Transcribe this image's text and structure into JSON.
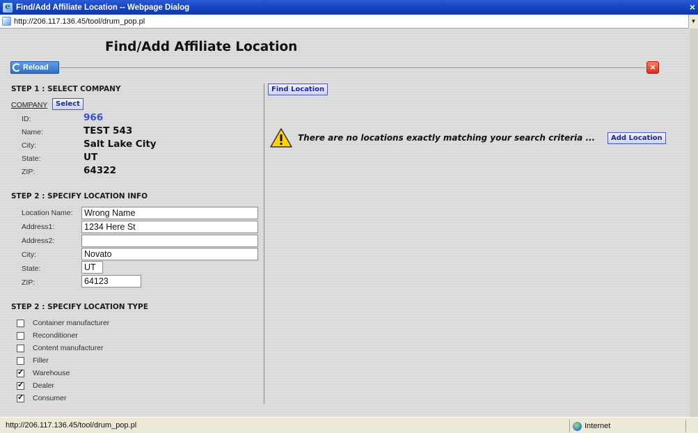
{
  "window": {
    "title": "Find/Add Affiliate Location -- Webpage Dialog",
    "close_glyph": "×",
    "address": "http://206.117.136.45/tool/drum_pop.pl"
  },
  "page": {
    "title": "Find/Add Affiliate Location",
    "reload_label": "Reload",
    "close_glyph": "×"
  },
  "step1": {
    "heading": "STEP 1 : SELECT COMPANY",
    "company_link": "COMPANY",
    "select_label": "Select",
    "fields": {
      "id_label": "ID:",
      "id_value": "966",
      "name_label": "Name:",
      "name_value": "TEST 543",
      "city_label": "City:",
      "city_value": "Salt Lake City",
      "state_label": "State:",
      "state_value": "UT",
      "zip_label": "ZIP:",
      "zip_value": "64322"
    }
  },
  "step2_info": {
    "heading": "STEP 2 : SPECIFY LOCATION INFO",
    "location_name_label": "Location Name:",
    "location_name_value": "Wrong Name",
    "address1_label": "Address1:",
    "address1_value": "1234 Here St",
    "address2_label": "Address2:",
    "address2_value": "",
    "city_label": "City:",
    "city_value": "Novato",
    "state_label": "State:",
    "state_value": "UT",
    "zip_label": "ZIP:",
    "zip_value": "64123"
  },
  "step2_type": {
    "heading": "STEP 2 : SPECIFY LOCATION TYPE",
    "options": [
      {
        "label": "Container manufacturer",
        "checked": false
      },
      {
        "label": "Reconditioner",
        "checked": false
      },
      {
        "label": "Content manufacturer",
        "checked": false
      },
      {
        "label": "Filler",
        "checked": false
      },
      {
        "label": "Warehouse",
        "checked": true
      },
      {
        "label": "Dealer",
        "checked": true
      },
      {
        "label": "Consumer",
        "checked": true
      }
    ]
  },
  "results": {
    "find_label": "Find Location",
    "message": "There are no locations exactly matching your search criteria  ...",
    "add_label": "Add Location"
  },
  "statusbar": {
    "url": "http://206.117.136.45/tool/drum_pop.pl",
    "zone": "Internet"
  },
  "colors": {
    "titlebar": "#1846c2",
    "id_value": "#3a4fd1",
    "button_text": "#1e2a85"
  }
}
